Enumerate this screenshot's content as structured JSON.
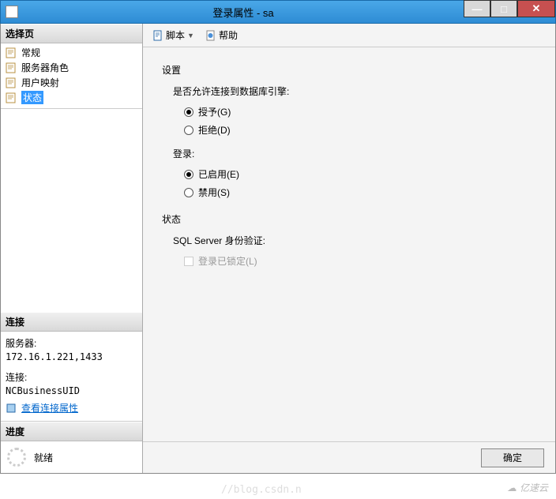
{
  "window": {
    "title": "登录属性 - sa"
  },
  "sidebar": {
    "select_page": {
      "header": "选择页",
      "items": [
        {
          "label": "常规"
        },
        {
          "label": "服务器角色"
        },
        {
          "label": "用户映射"
        },
        {
          "label": "状态",
          "selected": true
        }
      ]
    },
    "connection": {
      "header": "连接",
      "server_label": "服务器:",
      "server_value": "172.16.1.221,1433",
      "conn_label": "连接:",
      "conn_value": "NCBusinessUID",
      "view_props": "查看连接属性"
    },
    "progress": {
      "header": "进度",
      "status": "就绪"
    }
  },
  "toolbar": {
    "script": "脚本",
    "help": "帮助"
  },
  "content": {
    "settings_title": "设置",
    "allow_connect_label": "是否允许连接到数据库引擎:",
    "grant": "授予(G)",
    "deny": "拒绝(D)",
    "login_label": "登录:",
    "enabled": "已启用(E)",
    "disabled": "禁用(S)",
    "status_title": "状态",
    "sql_auth_label": "SQL Server 身份验证:",
    "locked": "登录已锁定(L)"
  },
  "footer": {
    "ok": "确定"
  },
  "watermark": {
    "brand": "亿速云",
    "blog": "//blog.csdn.n"
  }
}
